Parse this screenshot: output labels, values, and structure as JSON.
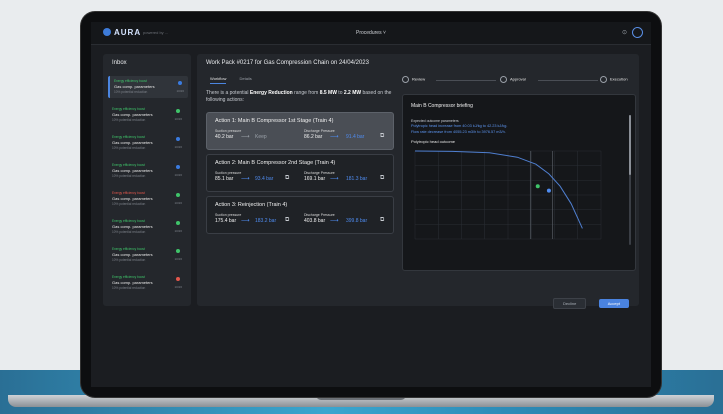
{
  "app": {
    "logo": "AURA",
    "subtitle": "powered by ...",
    "nav": "Procedures ˅"
  },
  "inbox": {
    "title": "Inbox",
    "items": [
      {
        "tag": "Energy efficiency boost",
        "title": "Gas comp. parameters",
        "desc": "10% potential reduction",
        "date": "10/26",
        "dot": "#3a7be0",
        "tag_color": "#3fc46a"
      },
      {
        "tag": "Energy efficiency boost",
        "title": "Gas comp. parameters",
        "desc": "10% potential reduction",
        "date": "10/26",
        "dot": "#3fc46a",
        "tag_color": "#3fc46a"
      },
      {
        "tag": "Energy efficiency boost",
        "title": "Gas comp. parameters",
        "desc": "10% potential reduction",
        "date": "10/26",
        "dot": "#3a7be0",
        "tag_color": "#3fc46a"
      },
      {
        "tag": "Energy efficiency boost",
        "title": "Gas comp. parameters",
        "desc": "10% potential reduction",
        "date": "10/26",
        "dot": "#3a7be0",
        "tag_color": "#3fc46a"
      },
      {
        "tag": "Energy efficiency boost",
        "title": "Gas comp. parameters",
        "desc": "10% potential reduction",
        "date": "10/26",
        "dot": "#3fc46a",
        "tag_color": "#e2574c"
      },
      {
        "tag": "Energy efficiency boost",
        "title": "Gas comp. parameters",
        "desc": "10% potential reduction",
        "date": "10/26",
        "dot": "#3fc46a",
        "tag_color": "#3fc46a"
      },
      {
        "tag": "Energy efficiency boost",
        "title": "Gas comp. parameters",
        "desc": "10% potential reduction",
        "date": "10/26",
        "dot": "#3fc46a",
        "tag_color": "#3fc46a"
      },
      {
        "tag": "Energy efficiency boost",
        "title": "Gas comp. parameters",
        "desc": "10% potential reduction",
        "date": "10/26",
        "dot": "#e2574c",
        "tag_color": "#3fc46a"
      }
    ]
  },
  "main": {
    "title": "Work Pack #0217 for Gas Compression Chain on 24/04/2023",
    "tabs": [
      "Workflow",
      "Details"
    ],
    "intro_pre": "There is a potential ",
    "intro_bold": "Energy Reduction",
    "intro_mid": " range from ",
    "intro_b1": "8.5 MW",
    "intro_to": " to ",
    "intro_b2": "2.2 MW",
    "intro_post": " based on the following actions:",
    "actions": [
      {
        "title": "Action 1: Main B Compressor  1st Stage (Train 4)",
        "l1": "Suction pressure",
        "v1": "40.2 bar",
        "n1": "Keep",
        "l2": "Discharge Pressure",
        "v2": "86.2 bar",
        "n2": "91.4 bar"
      },
      {
        "title": "Action 2: Main B Compressor  2nd Stage (Train 4)",
        "l1": "Suction pressure",
        "v1": "85.1 bar",
        "n1": "93.4 bar",
        "l2": "Discharge Pressure",
        "v2": "169.1 bar",
        "n2": "181.3 bar"
      },
      {
        "title": "Action 3: Reinjection (Train 4)",
        "l1": "Suction pressure",
        "v1": "175.4 bar",
        "n1": "183.2 bar",
        "l2": "Discharge Pressure",
        "v2": "403.8 bar",
        "n2": "399.8 bar"
      }
    ],
    "steps": [
      "Review",
      "Approval",
      "Execution"
    ],
    "briefing": {
      "title": "Main B Compressor briefing",
      "label": "Expected outcome parameters",
      "line1": "Polytropic head increase from 40.03 kJ/kg to 42.23 kJ/kg.",
      "line2": "Flow rate decrease from 4055.23 m3/h to 3976.57 m3/h."
    },
    "buttons": {
      "secondary": "Decline",
      "primary": "Accept"
    }
  },
  "chart_data": {
    "type": "line",
    "title": "Polytropic head outcome",
    "colors": {
      "curve": "#4f7fd0",
      "current": "#4f8cf0",
      "suggested": "#3fc46a"
    },
    "curve": {
      "x": [
        0,
        0.2,
        0.4,
        0.55,
        0.65,
        0.72,
        0.78,
        0.84,
        0.9
      ],
      "y": [
        1,
        0.995,
        0.98,
        0.93,
        0.85,
        0.74,
        0.6,
        0.4,
        0.12
      ]
    },
    "points": [
      {
        "name": "current",
        "x": 0.72,
        "y": 0.55
      },
      {
        "name": "suggested",
        "x": 0.66,
        "y": 0.6
      }
    ],
    "vlines": [
      0.62,
      0.74
    ],
    "grid": true
  }
}
